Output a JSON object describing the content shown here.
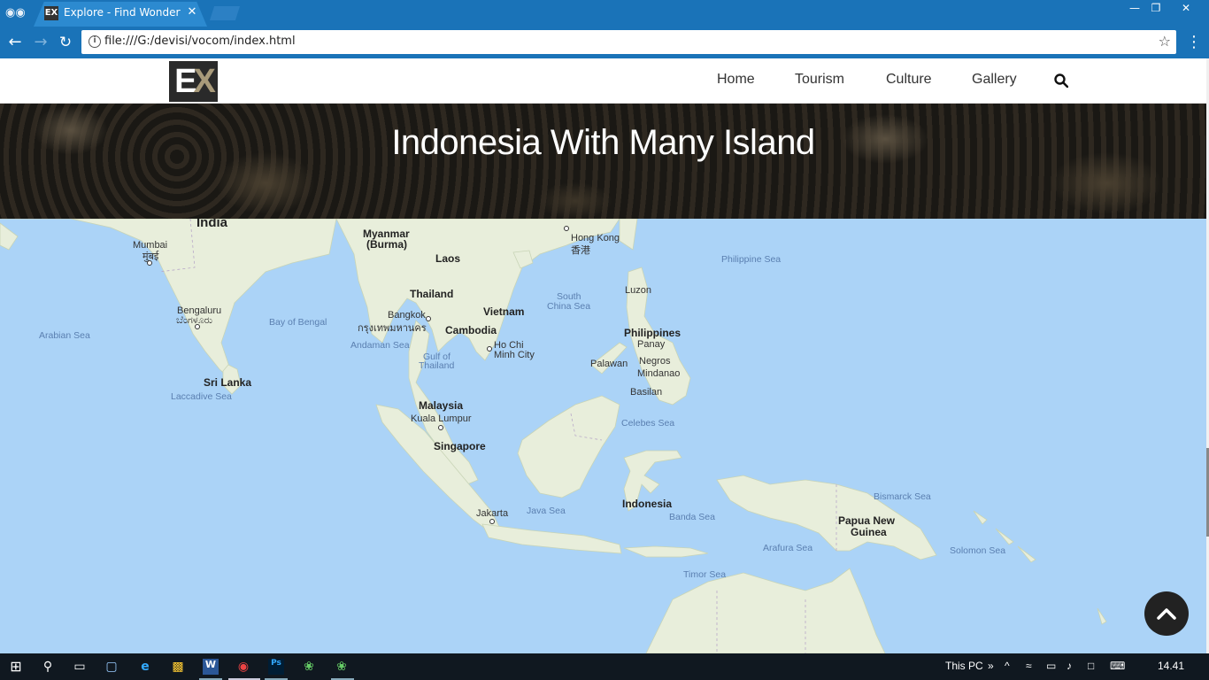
{
  "browser": {
    "tab_title": "Explore - Find Wonderful",
    "tab_favicon": "EX",
    "url": "file:///G:/devisi/vocom/index.html"
  },
  "site": {
    "logo_text_1": "E",
    "logo_text_2": "X",
    "nav": [
      "Home",
      "Tourism",
      "Culture",
      "Gallery"
    ],
    "banner_title": "Indonesia With Many Island"
  },
  "map": {
    "countries": {
      "india": "India",
      "myanmar": "Myanmar",
      "myanmar_sub": "(Burma)",
      "laos": "Laos",
      "thailand": "Thailand",
      "vietnam": "Vietnam",
      "cambodia": "Cambodia",
      "philippines": "Philippines",
      "malaysia": "Malaysia",
      "singapore": "Singapore",
      "indonesia": "Indonesia",
      "srilanka": "Sri Lanka",
      "png_1": "Papua New",
      "png_2": "Guinea"
    },
    "cities": {
      "mumbai": "Mumbai",
      "mumbai_local": "मुंबई",
      "bengaluru": "Bengaluru",
      "bengaluru_local": "ಬೆಂಗಳೂರು",
      "bangkok": "Bangkok",
      "bangkok_local": "กรุงเทพมหานคร",
      "hongkong": "Hong Kong",
      "hongkong_local": "香港",
      "hochiminh_1": "Ho Chi",
      "hochiminh_2": "Minh City",
      "kualalumpur": "Kuala Lumpur",
      "jakarta": "Jakarta",
      "luzon": "Luzon",
      "panay": "Panay",
      "negros": "Negros",
      "mindanao": "Mindanao",
      "palawan": "Palawan",
      "basilan": "Basilan"
    },
    "seas": {
      "arabian": "Arabian Sea",
      "bengal": "Bay of Bengal",
      "andaman": "Andaman Sea",
      "laccadive": "Laccadive Sea",
      "gulf_1": "Gulf of",
      "gulf_2": "Thailand",
      "southchina_1": "South",
      "southchina_2": "China Sea",
      "philippine": "Philippine Sea",
      "celebes": "Celebes Sea",
      "java": "Java Sea",
      "banda": "Banda Sea",
      "arafura": "Arafura Sea",
      "timor": "Timor Sea",
      "bismarck": "Bismarck Sea",
      "solomon": "Solomon Sea"
    }
  },
  "taskbar": {
    "tray_label": "This PC",
    "clock": "14.41"
  },
  "icons": {
    "back": "arrow-left-icon",
    "forward": "arrow-right-icon",
    "reload": "reload-icon",
    "info": "info-icon",
    "bookmark": "star-icon",
    "search": "search-icon",
    "to_top": "chevron-up-icon"
  }
}
